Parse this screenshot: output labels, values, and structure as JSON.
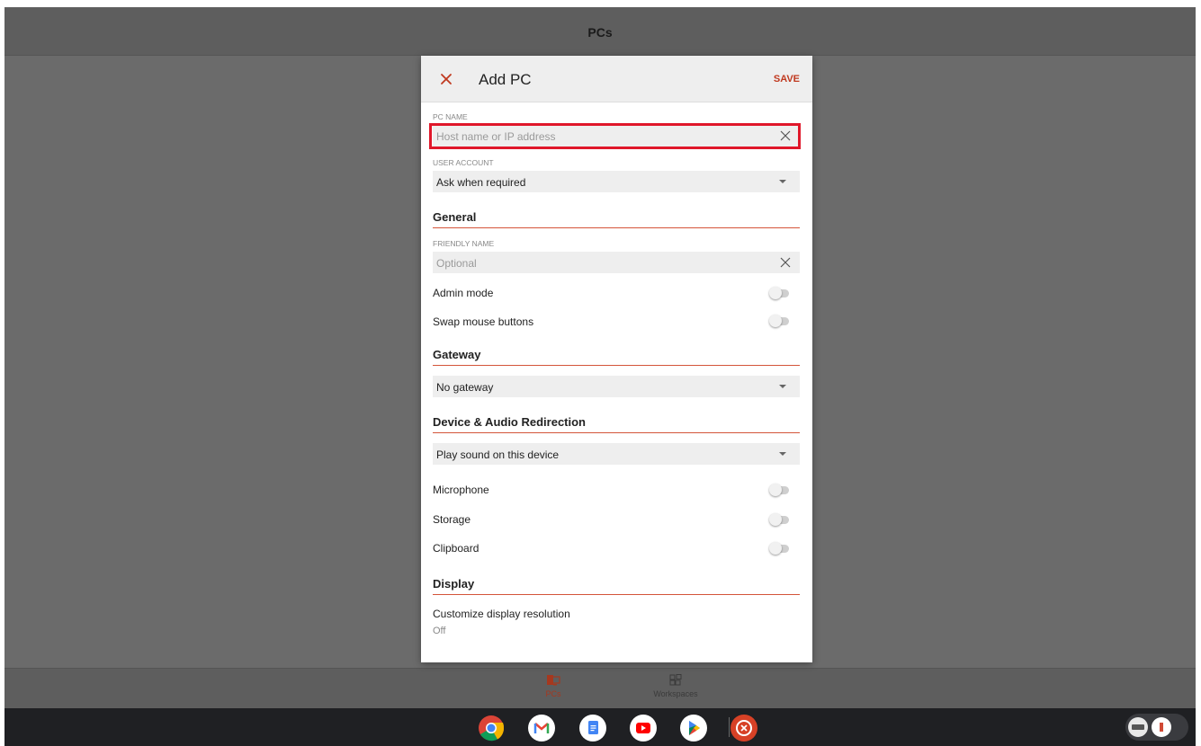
{
  "app": {
    "title": "PCs",
    "nav": [
      {
        "label": "PCs",
        "active": true,
        "icon": "pc-icon"
      },
      {
        "label": "Workspaces",
        "active": false,
        "icon": "workspaces-icon"
      }
    ]
  },
  "dialog": {
    "title": "Add PC",
    "save_label": "SAVE",
    "pc_name": {
      "label": "PC NAME",
      "placeholder": "Host name or IP address",
      "value": ""
    },
    "user_account": {
      "label": "USER ACCOUNT",
      "value": "Ask when required"
    },
    "general": {
      "heading": "General",
      "friendly_name": {
        "label": "FRIENDLY NAME",
        "placeholder": "Optional",
        "value": ""
      },
      "admin_mode": {
        "label": "Admin mode",
        "on": false
      },
      "swap_mouse": {
        "label": "Swap mouse buttons",
        "on": false
      }
    },
    "gateway": {
      "heading": "Gateway",
      "value": "No gateway"
    },
    "device_audio": {
      "heading": "Device & Audio Redirection",
      "sound": "Play sound on this device",
      "microphone": {
        "label": "Microphone",
        "on": false
      },
      "storage": {
        "label": "Storage",
        "on": false
      },
      "clipboard": {
        "label": "Clipboard",
        "on": false
      }
    },
    "display": {
      "heading": "Display",
      "customize_label": "Customize display resolution",
      "customize_value": "Off"
    }
  },
  "shelf": {
    "apps": [
      "chrome-icon",
      "gmail-icon",
      "docs-icon",
      "youtube-icon",
      "play-store-icon",
      "remote-desktop-icon"
    ]
  },
  "colors": {
    "accent": "#c0391f",
    "highlight": "#e0172a"
  }
}
